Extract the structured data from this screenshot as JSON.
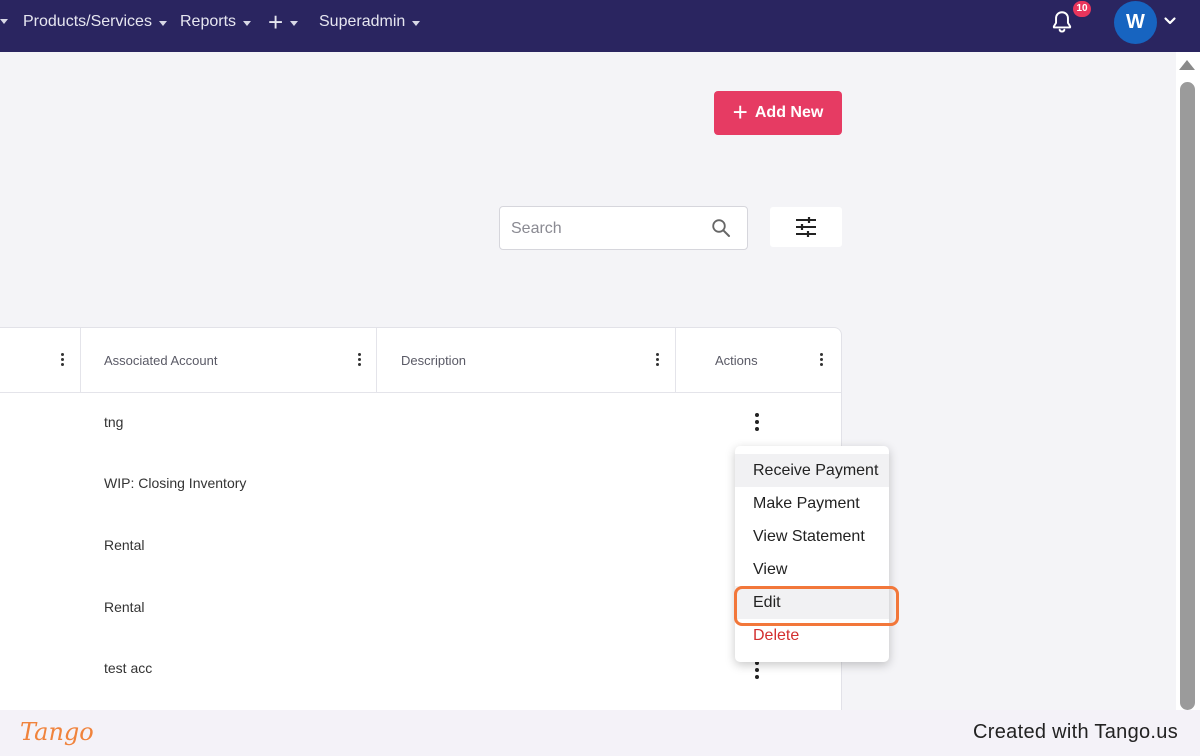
{
  "nav": {
    "items": [
      {
        "label": "Products/Services"
      },
      {
        "label": "Reports"
      },
      {
        "label": "+"
      },
      {
        "label": "Superadmin"
      }
    ],
    "notifications_count": "10",
    "avatar_initial": "W"
  },
  "toolbar": {
    "add_new_label": "Add New",
    "search_placeholder": "Search"
  },
  "table": {
    "columns": [
      {
        "label": ""
      },
      {
        "label": "Associated Account"
      },
      {
        "label": "Description"
      },
      {
        "label": "Actions"
      }
    ],
    "rows": [
      {
        "associated_account": "tng"
      },
      {
        "associated_account": "WIP: Closing Inventory"
      },
      {
        "associated_account": "Rental"
      },
      {
        "associated_account": "Rental"
      },
      {
        "associated_account": "test acc"
      }
    ]
  },
  "actions_menu": {
    "items": [
      {
        "label": "Receive Payment"
      },
      {
        "label": "Make Payment"
      },
      {
        "label": "View Statement"
      },
      {
        "label": "View"
      },
      {
        "label": "Edit"
      },
      {
        "label": "Delete"
      }
    ]
  },
  "colors": {
    "nav_bg": "#2a2560",
    "accent": "#e63b63",
    "highlight": "#f2773a",
    "danger": "#d32f2f"
  },
  "footer": {
    "logo_text": "Tango",
    "credit_text": "Created with Tango.us"
  }
}
